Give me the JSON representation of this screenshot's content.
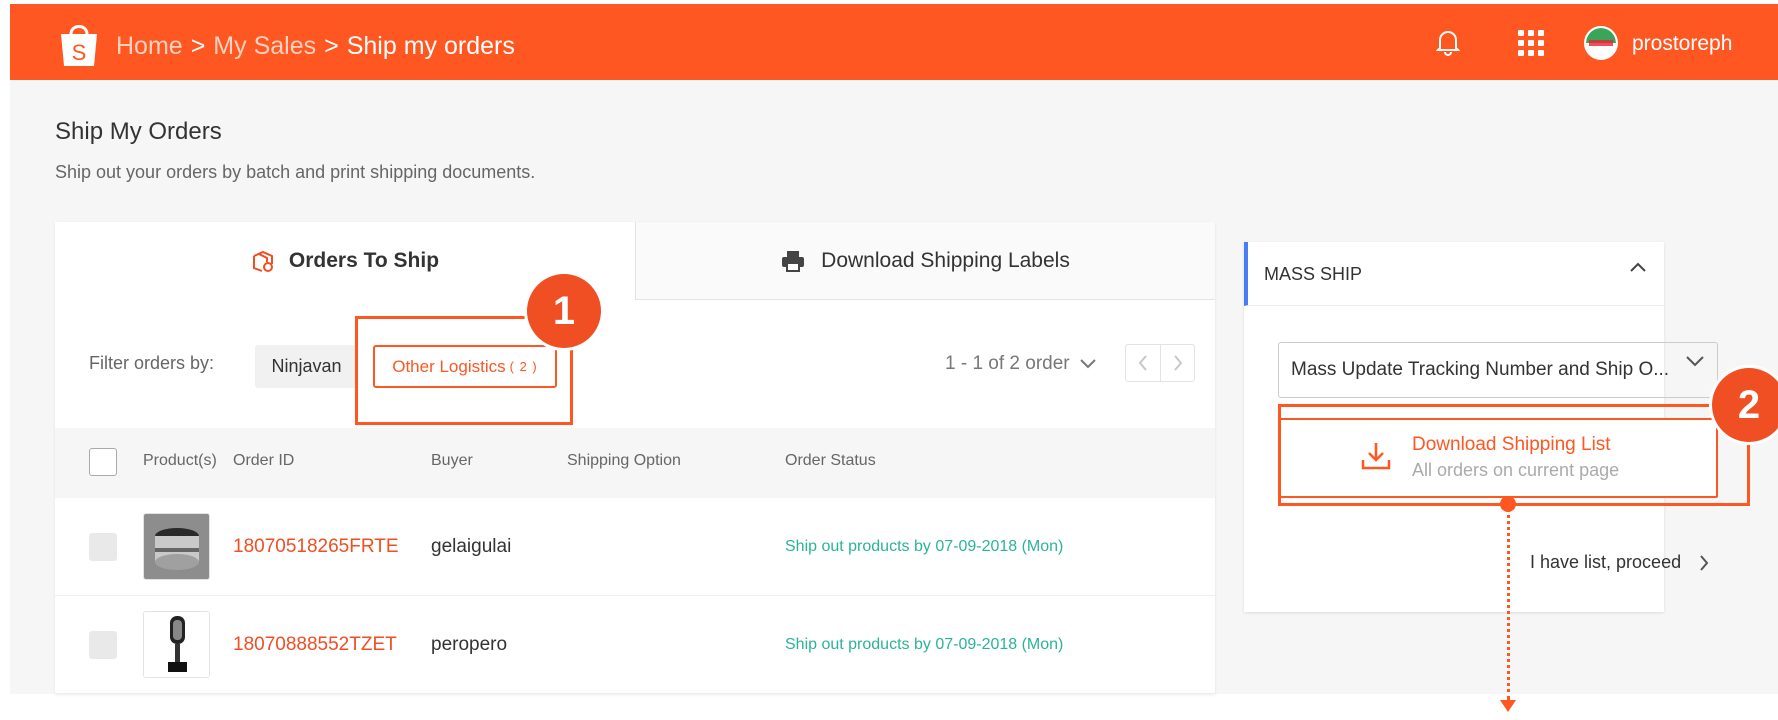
{
  "colors": {
    "brand": "#fe5722",
    "accent_blue": "#4a7cf6",
    "status_green": "#2bb39a"
  },
  "header": {
    "breadcrumb": {
      "home": "Home",
      "sales": "My Sales",
      "current": "Ship my orders",
      "separator": ">"
    },
    "username": "prostoreph",
    "icons": {
      "bell": "bell-icon",
      "apps": "apps-grid-icon",
      "logo": "shopee-bag-logo"
    }
  },
  "page": {
    "title": "Ship My Orders",
    "subtitle": "Ship out your orders by batch and print shipping documents."
  },
  "tabs": [
    {
      "label": "Orders To Ship",
      "icon": "package-icon",
      "active": true
    },
    {
      "label": "Download Shipping Labels",
      "icon": "printer-icon",
      "active": false
    }
  ],
  "filter": {
    "label": "Filter orders by:",
    "options": [
      {
        "label": "Ninjavan",
        "selected": false
      },
      {
        "label": "Other Logistics",
        "count": "( 2 )",
        "selected": true
      }
    ]
  },
  "pagination": {
    "summary": "1 - 1 of 2 order"
  },
  "table": {
    "headers": [
      "Product(s)",
      "Order ID",
      "Buyer",
      "Shipping Option",
      "Order Status"
    ],
    "rows": [
      {
        "order_id": "18070518265FRTE",
        "buyer": "gelaigulai",
        "shipping_option": "",
        "status": "Ship out products by 07-09-2018 (Mon)",
        "product": "speaker-product-image"
      },
      {
        "order_id": "18070888552TZET",
        "buyer": "peropero",
        "shipping_option": "",
        "status": "Ship out products by 07-09-2018 (Mon)",
        "product": "microphone-product-image"
      }
    ]
  },
  "mass_ship": {
    "title": "MASS SHIP",
    "select_value": "Mass Update Tracking Number and Ship O...",
    "download_title": "Download Shipping List",
    "download_sub": "All orders on current page",
    "proceed": "I have list, proceed"
  },
  "callouts": {
    "one": "1",
    "two": "2"
  }
}
